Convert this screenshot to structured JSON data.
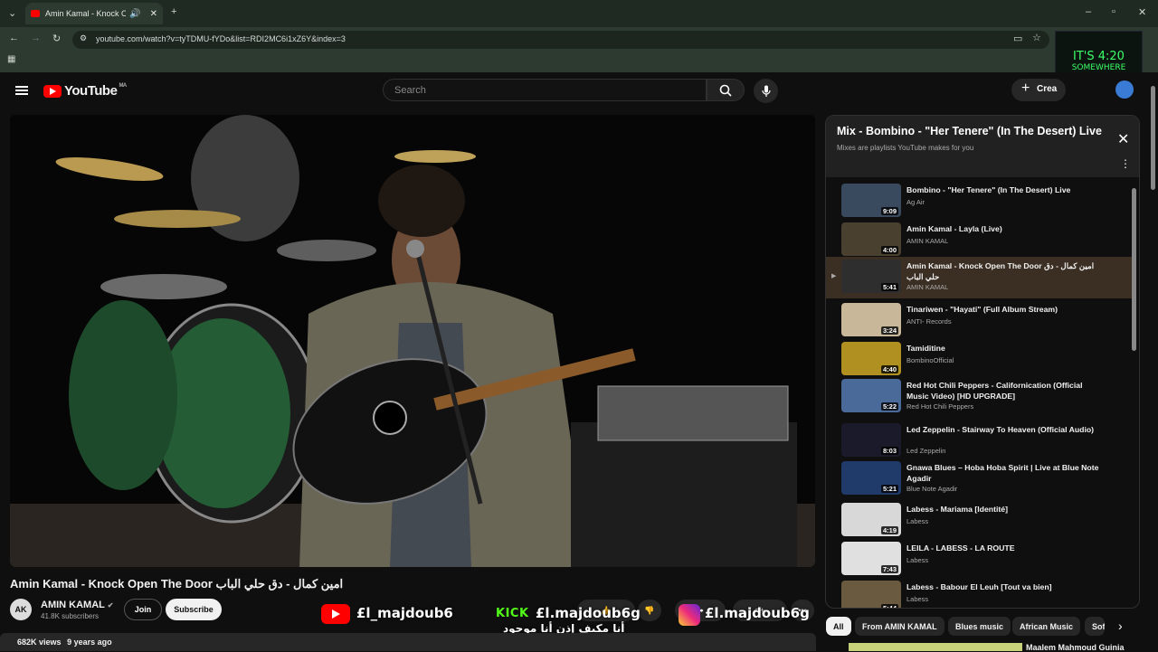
{
  "browser": {
    "tab_title": "Amin Kamal - Knock Open The Door",
    "url": "youtube.com/watch?v=tyTDMU-fYDo&list=RDI2MC6i1xZ6Y&index=3"
  },
  "overlay_image": {
    "line1": "IT'S 4:20",
    "line2": "SOMEWHERE"
  },
  "header": {
    "logo_text": "YouTube",
    "country_code": "MA",
    "search_placeholder": "Search",
    "create_label": "Crea"
  },
  "video": {
    "title": "Amin Kamal - Knock Open The Door امين كمال - دق حلي الباب",
    "channel_name": "AMIN KAMAL",
    "channel_initials": "AK",
    "subscribers": "41.8K subscribers",
    "join_label": "Join",
    "subscribe_label": "Subscribe",
    "views": "682K views",
    "age": "9 years ago"
  },
  "stream_overlay": {
    "youtube_handle": "£l_majdoub6",
    "kick_label": "KICK",
    "kick_handle": "£l.majdoub6g",
    "instagram_handle": "£l.majdoub6g",
    "arabic_caption": "أنا مكيف إذن أنا موجود"
  },
  "playlist": {
    "title": "Mix - Bombino - \"Her Tenere\" (In The Desert) Live",
    "subtitle": "Mixes are playlists YouTube makes for you",
    "items": [
      {
        "title": "Bombino - \"Her Tenere\" (In The Desert) Live",
        "channel": "Ag Air",
        "duration": "9:09",
        "color": "#3a4a5e"
      },
      {
        "title": "Amin Kamal - Layla (Live)",
        "channel": "AMIN KAMAL",
        "duration": "4:00",
        "color": "#4a4030"
      },
      {
        "title": "Amin Kamal - Knock Open The Door امين كمال - دق حلي الباب",
        "channel": "AMIN KAMAL",
        "duration": "5:41",
        "color": "#2e2e2e"
      },
      {
        "title": "Tinariwen - \"Hayati\" (Full Album Stream)",
        "channel": "ANTI- Records",
        "duration": "3:24",
        "color": "#c9b79a"
      },
      {
        "title": "Tamiditine",
        "channel": "BombinoOfficial",
        "duration": "4:40",
        "color": "#b09020"
      },
      {
        "title": "Red Hot Chili Peppers - Californication (Official Music Video) [HD UPGRADE]",
        "channel": "Red Hot Chili Peppers",
        "duration": "5:22",
        "color": "#4a6a9a"
      },
      {
        "title": "Led Zeppelin - Stairway To Heaven (Official Audio)",
        "channel": "Led Zeppelin",
        "duration": "8:03",
        "color": "#1a1a2a"
      },
      {
        "title": "Gnawa Blues – Hoba Hoba Spirit | Live at Blue Note Agadir",
        "channel": "Blue Note Agadir",
        "duration": "5:21",
        "color": "#203a6a"
      },
      {
        "title": "Labess - Mariama [Identité]",
        "channel": "Labess",
        "duration": "4:19",
        "color": "#d8d8d8"
      },
      {
        "title": "LEILA - LABESS - LA ROUTE",
        "channel": "Labess",
        "duration": "7:43",
        "color": "#e0e0e0"
      },
      {
        "title": "Labess - Babour El Leuh [Tout va bien]",
        "channel": "Labess",
        "duration": "5:44",
        "color": "#6a5a40"
      }
    ]
  },
  "chips": [
    "All",
    "From AMIN KAMAL",
    "Blues music",
    "African Music",
    "Soft"
  ],
  "recommended": {
    "title": "Maalem Mahmoud Guinia"
  }
}
